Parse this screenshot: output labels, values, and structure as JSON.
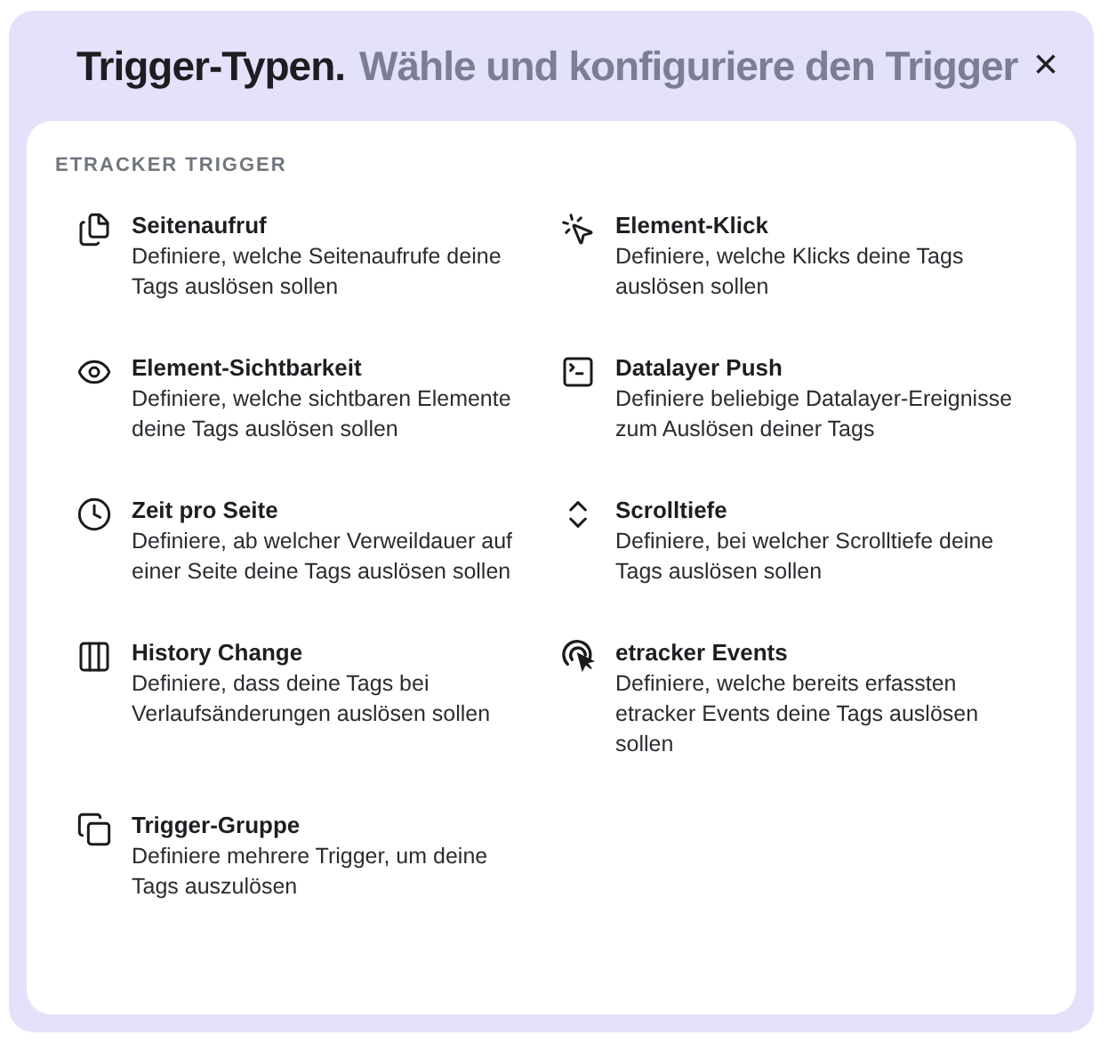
{
  "dialog": {
    "title": "Trigger-Typen.",
    "subtitle": "Wähle und konfiguriere den Trigger",
    "close": "×"
  },
  "section": {
    "heading": "ETRACKER TRIGGER"
  },
  "triggers": [
    {
      "title": "Seitenaufruf",
      "description": "Definiere, welche Seitenaufrufe deine Tags auslösen sollen"
    },
    {
      "title": "Element-Klick",
      "description": "Definiere, welche Klicks deine Tags auslösen sollen"
    },
    {
      "title": "Element-Sichtbarkeit",
      "description": "Definiere, welche sichtbaren Elemente deine Tags auslösen sollen"
    },
    {
      "title": "Datalayer Push",
      "description": "Definiere beliebige Datalayer-Ereignisse zum Auslösen deiner Tags"
    },
    {
      "title": "Zeit pro Seite",
      "description": "Definiere, ab welcher Verweildauer auf einer Seite deine Tags auslösen sollen"
    },
    {
      "title": "Scrolltiefe",
      "description": "Definiere, bei welcher Scrolltiefe deine Tags auslösen sollen"
    },
    {
      "title": "History Change",
      "description": "Definiere, dass deine Tags bei Verlaufsänderungen auslösen sollen"
    },
    {
      "title": "etracker Events",
      "description": "Definiere, welche bereits erfassten etracker Events deine Tags auslösen sollen"
    },
    {
      "title": "Trigger-Gruppe",
      "description": "Definiere mehrere Trigger, um deine Tags auszulösen"
    }
  ]
}
